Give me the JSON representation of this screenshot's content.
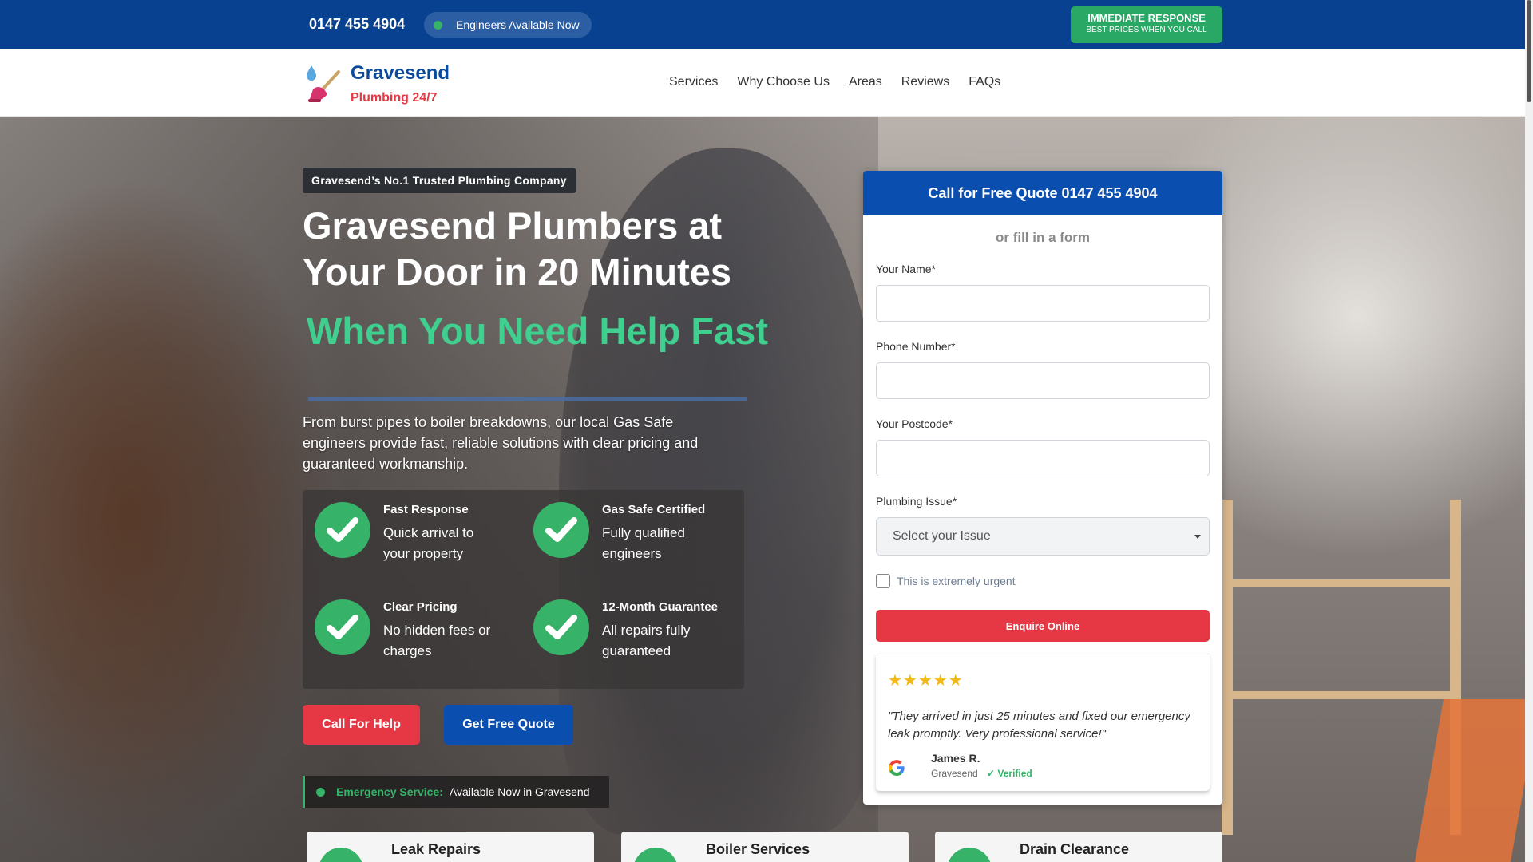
{
  "topbar": {
    "phone": "0147 455 4904",
    "availability": "Engineers Available Now",
    "cta_title": "IMMEDIATE RESPONSE",
    "cta_subtitle": "BEST PRICES WHEN YOU CALL"
  },
  "brand": {
    "name": "Gravesend",
    "tagline": "Plumbing 24/7",
    "logo_icon": "plunger-droplet-icon"
  },
  "nav": {
    "items": [
      "Services",
      "Why Choose Us",
      "Areas",
      "Reviews",
      "FAQs"
    ]
  },
  "hero": {
    "badge": "Gravesend’s No.1 Trusted Plumbing Company",
    "title": "Gravesend Plumbers at Your Door in 20 Minutes",
    "highlight": "When You Need Help Fast",
    "lead": "From burst pipes to boiler breakdowns, our local Gas Safe engineers provide fast, reliable solutions with clear pricing and guaranteed workmanship.",
    "features": [
      {
        "title": "Fast Response",
        "desc": "Quick arrival to your property"
      },
      {
        "title": "Gas Safe Certified",
        "desc": "Fully qualified engineers"
      },
      {
        "title": "Clear Pricing",
        "desc": "No hidden fees or charges"
      },
      {
        "title": "12-Month Guarantee",
        "desc": "All repairs fully guaranteed"
      }
    ],
    "call_button": "Call For Help",
    "quote_button": "Get Free Quote",
    "emergency_label": "Emergency Service:",
    "emergency_text": "Available Now in Gravesend"
  },
  "services": [
    "Leak Repairs",
    "Boiler Services",
    "Drain Clearance"
  ],
  "form": {
    "header": "Call for Free Quote 0147 455 4904",
    "subheader": "or fill in a form",
    "name_label": "Your Name*",
    "phone_label": "Phone Number*",
    "postcode_label": "Your Postcode*",
    "issue_label": "Plumbing Issue*",
    "issue_selected": "Select your Issue",
    "urgent_label": "This is extremely urgent",
    "submit_label": "Enquire Online"
  },
  "review": {
    "rating": 5,
    "stars": "★★★★★",
    "quote": "\"They arrived in just 25 minutes and fixed our emergency leak promptly. Very professional service!\"",
    "name": "James R.",
    "location": "Gravesend",
    "verified": "✓ Verified"
  },
  "colors": {
    "primary": "#08418f",
    "accent_green": "#36b368",
    "accent_red": "#e53844",
    "button_blue": "#0a4fb0"
  }
}
